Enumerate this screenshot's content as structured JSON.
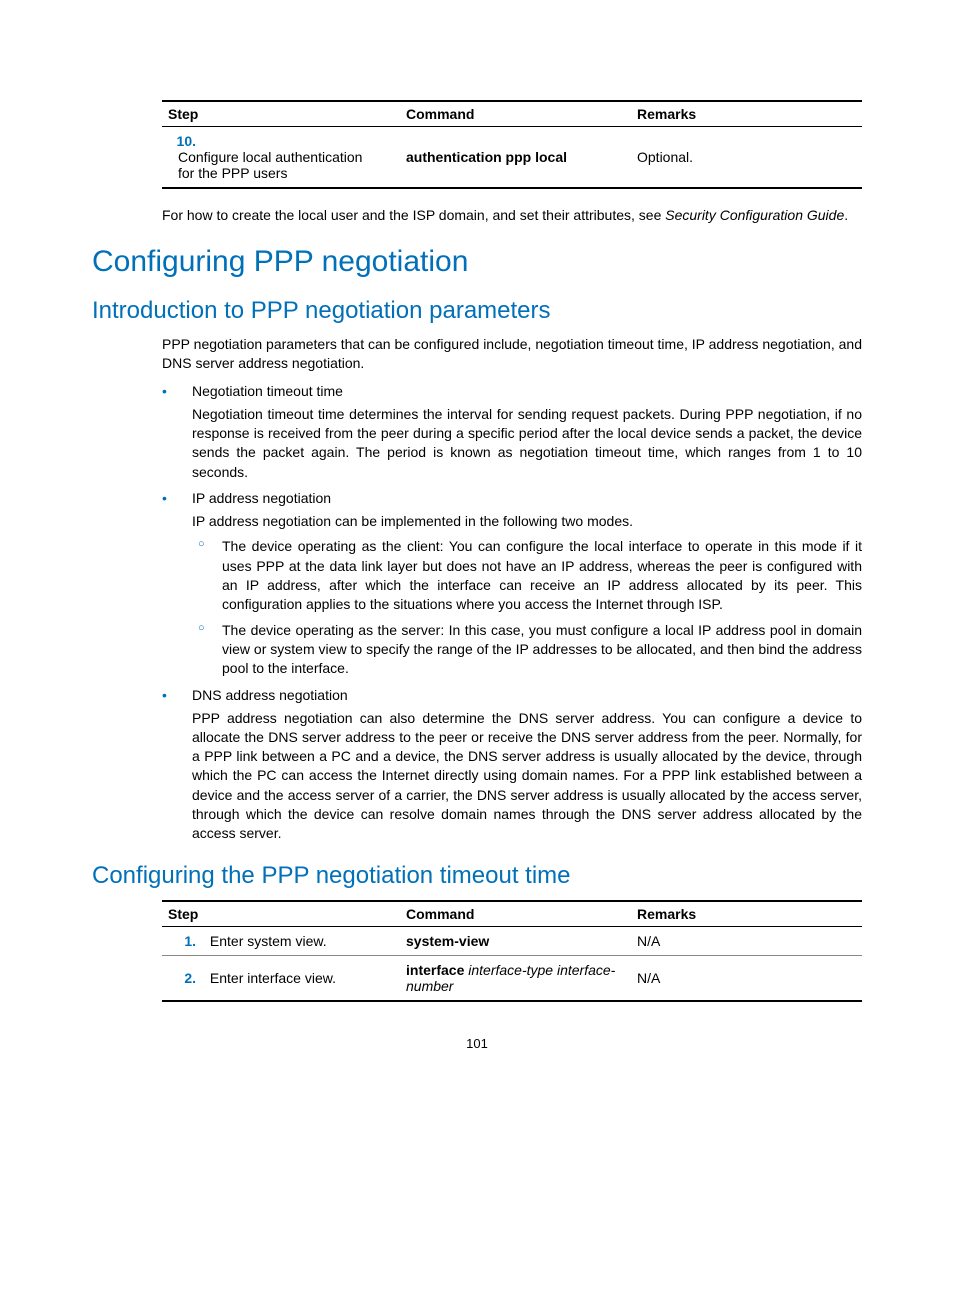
{
  "table1": {
    "headers": {
      "step": "Step",
      "command": "Command",
      "remarks": "Remarks"
    },
    "row": {
      "num": "10.",
      "desc": "Configure local authentication for the PPP users",
      "command": "authentication ppp local",
      "remarks": "Optional."
    }
  },
  "note_text_pre": "For how to create the local user and the ISP domain, and set their attributes, see ",
  "note_text_ital": "Security Configuration Guide",
  "note_text_end": ".",
  "h1": "Configuring PPP negotiation",
  "h2a": "Introduction to PPP negotiation parameters",
  "intro": "PPP negotiation parameters that can be configured include, negotiation timeout time, IP address negotiation, and DNS server address negotiation.",
  "b1_head": "Negotiation timeout time",
  "b1_body": "Negotiation timeout time determines the interval for sending request packets. During PPP negotiation, if no response is received from the peer during a specific period after the local device sends a packet, the device sends the packet again. The period is known as negotiation timeout time, which ranges from 1 to 10 seconds.",
  "b2_head": "IP address negotiation",
  "b2_body": "IP address negotiation can be implemented in the following two modes.",
  "b2_sub1": "The device operating as the client: You can configure the local interface to operate in this mode if it uses PPP at the data link layer but does not have an IP address, whereas the peer is configured with an IP address, after which the interface can receive an IP address allocated by its peer. This configuration applies to the situations where you access the Internet through ISP.",
  "b2_sub2": "The device operating as the server: In this case, you must configure a local IP address pool in domain view or system view to specify the range of the IP addresses to be allocated, and then bind the address pool to the interface.",
  "b3_head": "DNS address negotiation",
  "b3_body": "PPP address negotiation can also determine the DNS server address. You can configure a device to allocate the DNS server address to the peer or receive the DNS server address from the peer. Normally, for a PPP link between a PC and a device, the DNS server address is usually allocated by the device, through which the PC can access the Internet directly using domain names. For a PPP link established between a device and the access server of a carrier, the DNS server address is usually allocated by the access server, through which the device can resolve domain names through the DNS server address allocated by the access server.",
  "h2b": "Configuring the PPP negotiation timeout time",
  "table2": {
    "headers": {
      "step": "Step",
      "command": "Command",
      "remarks": "Remarks"
    },
    "rows": [
      {
        "num": "1.",
        "desc": "Enter system view.",
        "command_bold": "system-view",
        "command_ital": "",
        "remarks": "N/A"
      },
      {
        "num": "2.",
        "desc": "Enter interface view.",
        "command_bold": "interface",
        "command_ital": " interface-type interface-number",
        "remarks": "N/A"
      }
    ]
  },
  "page_number": "101"
}
